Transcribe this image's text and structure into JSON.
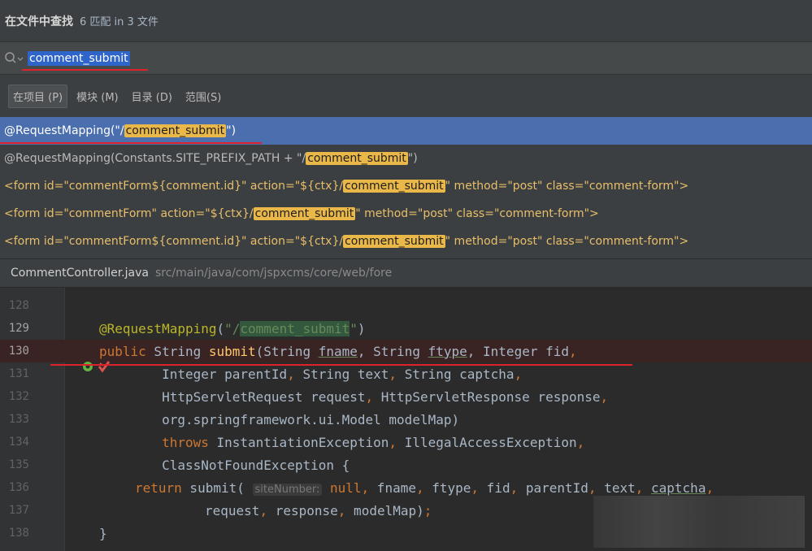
{
  "header": {
    "title": "在文件中查找",
    "count": "6 匹配 in 3 文件"
  },
  "search": {
    "query": "comment_submit",
    "icon": "search-icon"
  },
  "scopes": [
    {
      "label": "在项目 (P)",
      "active": true
    },
    {
      "label": "模块 (M)",
      "active": false
    },
    {
      "label": "目录 (D)",
      "active": false
    },
    {
      "label": "范围(S)",
      "active": false
    }
  ],
  "results": [
    {
      "pre": "@RequestMapping(\"/",
      "match": "comment_submit",
      "post": "\")"
    },
    {
      "pre": "@RequestMapping(Constants.SITE_PREFIX_PATH + \"/",
      "match": "comment_submit",
      "post": "\")"
    },
    {
      "pre": "<form id=\"commentForm${comment.id}\" action=\"${ctx}/",
      "match": "comment_submit",
      "post": "\" method=\"post\" class=\"comment-form\">"
    },
    {
      "pre": "<form id=\"commentForm\" action=\"${ctx}/",
      "match": "comment_submit",
      "post": "\" method=\"post\" class=\"comment-form\">"
    },
    {
      "pre": "<form id=\"commentForm${comment.id}\" action=\"${ctx}/",
      "match": "comment_submit",
      "post": "\" method=\"post\" class=\"comment-form\">"
    }
  ],
  "file": {
    "name": "CommentController.java",
    "path": "src/main/java/com/jspxcms/core/web/fore"
  },
  "editor": {
    "line_numbers": [
      "128",
      "129",
      "130",
      "131",
      "132",
      "133",
      "134",
      "135",
      "136",
      "137",
      "138"
    ],
    "hint": "siteNumber:"
  },
  "colors": {
    "selection": "#4b6eaf",
    "match_highlight": "#e9b849",
    "underline": "#e0212a"
  }
}
